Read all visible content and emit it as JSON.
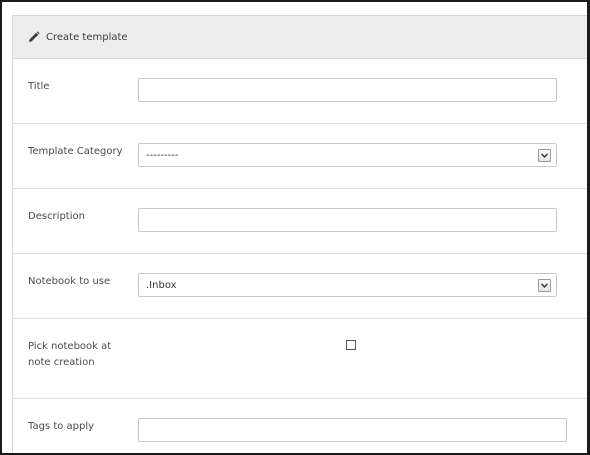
{
  "panel": {
    "title": "Create template",
    "title_icon": "pencil-icon"
  },
  "form": {
    "title_label": "Title",
    "title_value": "",
    "category_label": "Template Category",
    "category_selected": "---------",
    "description_label": "Description",
    "description_value": "",
    "notebook_label": "Notebook to use",
    "notebook_selected": ".Inbox",
    "pick_notebook_label_line1": "Pick notebook at",
    "pick_notebook_label_line2": "note creation",
    "pick_notebook_checked": false,
    "tags_label": "Tags to apply",
    "tags_value": ""
  }
}
